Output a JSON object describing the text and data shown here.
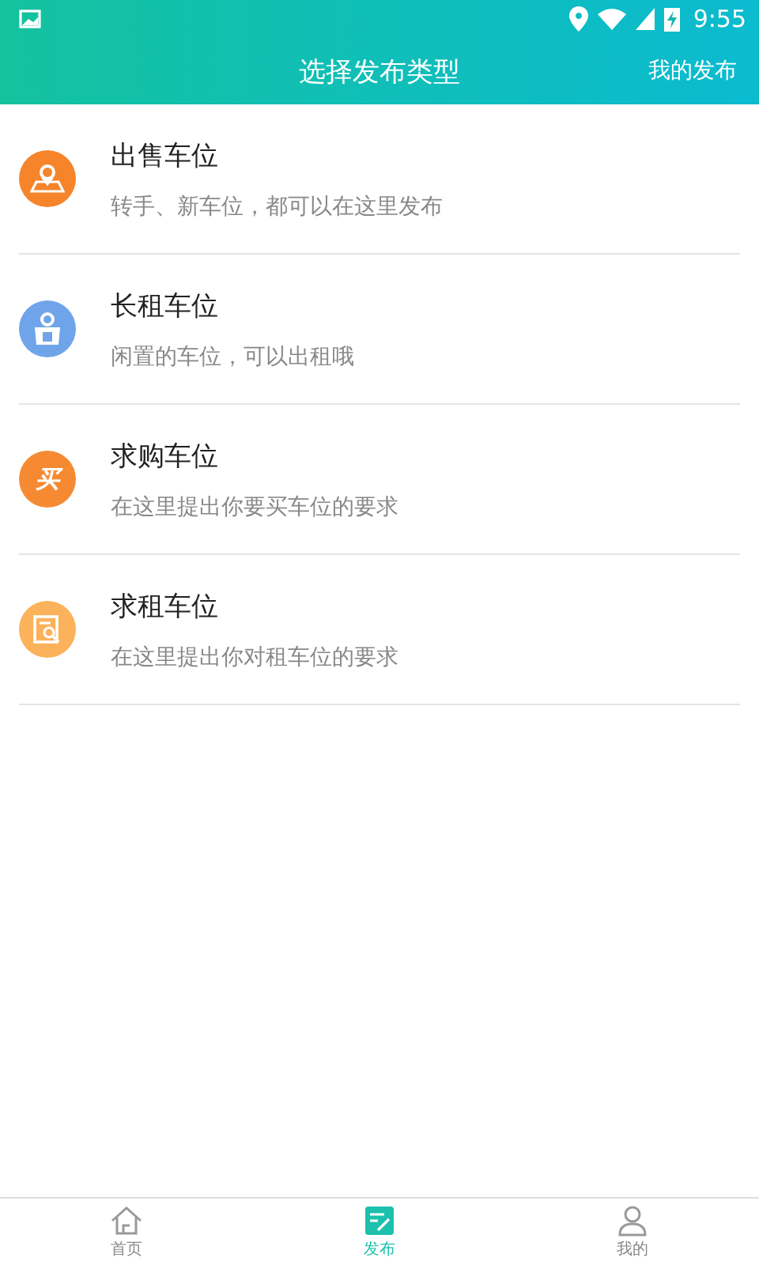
{
  "status_bar": {
    "time": "9:55"
  },
  "header": {
    "title": "选择发布类型",
    "action": "我的发布"
  },
  "items": [
    {
      "kind": "sale",
      "color": "#f5842a",
      "title": "出售车位",
      "subtitle": "转手、新车位，都可以在这里发布"
    },
    {
      "kind": "rent",
      "color": "#6fa4ea",
      "title": "长租车位",
      "subtitle": "闲置的车位，可以出租哦"
    },
    {
      "kind": "buy",
      "color": "#f58a33",
      "icon_char": "买",
      "title": "求购车位",
      "subtitle": "在这里提出你要买车位的要求"
    },
    {
      "kind": "seek",
      "color": "#fbb25a",
      "title": "求租车位",
      "subtitle": "在这里提出你对租车位的要求"
    }
  ],
  "tabs": [
    {
      "kind": "home",
      "label": "首页",
      "selected": false
    },
    {
      "kind": "publish",
      "label": "发布",
      "selected": true
    },
    {
      "kind": "mine",
      "label": "我的",
      "selected": false
    }
  ]
}
